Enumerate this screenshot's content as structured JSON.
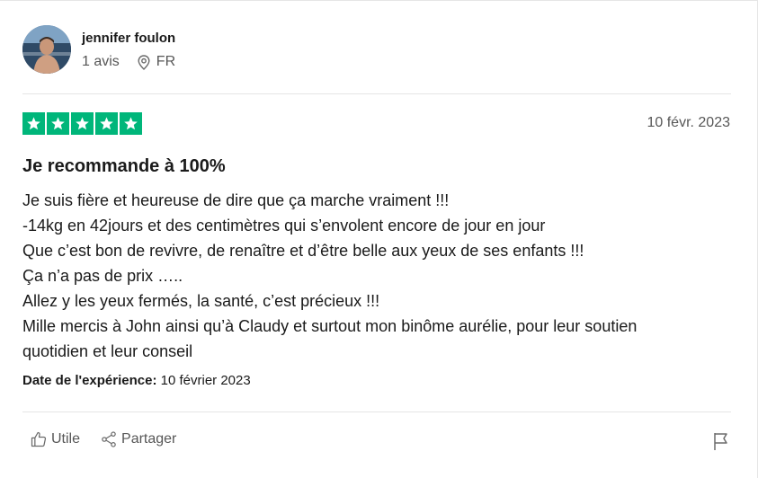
{
  "reviewer": {
    "name": "jennifer foulon",
    "review_count": "1 avis",
    "country": "FR"
  },
  "review": {
    "rating": 5,
    "max_rating": 5,
    "date": "10 févr. 2023",
    "title": "Je recommande à 100%",
    "lines": [
      "Je suis fière et heureuse de dire que ça marche vraiment !!!",
      "-14kg en 42jours et des centimètres qui s’envolent encore de jour en jour",
      "Que c’est bon de revivre, de renaître et d’être belle aux yeux de ses enfants !!!",
      "Ça n’a pas de prix …..",
      "Allez y les yeux fermés, la santé, c’est précieux !!!",
      "Mille mercis à John ainsi qu’à Claudy et surtout mon binôme aurélie, pour leur soutien",
      "quotidien et leur conseil"
    ],
    "experience_label": "Date de l'expérience:",
    "experience_date": "10 février 2023"
  },
  "actions": {
    "useful_label": "Utile",
    "share_label": "Partager"
  },
  "colors": {
    "star_green": "#00b67a",
    "muted_text": "#575757"
  },
  "icons": [
    "location-pin-icon",
    "star-icon",
    "thumbs-up-icon",
    "share-icon",
    "flag-icon"
  ]
}
